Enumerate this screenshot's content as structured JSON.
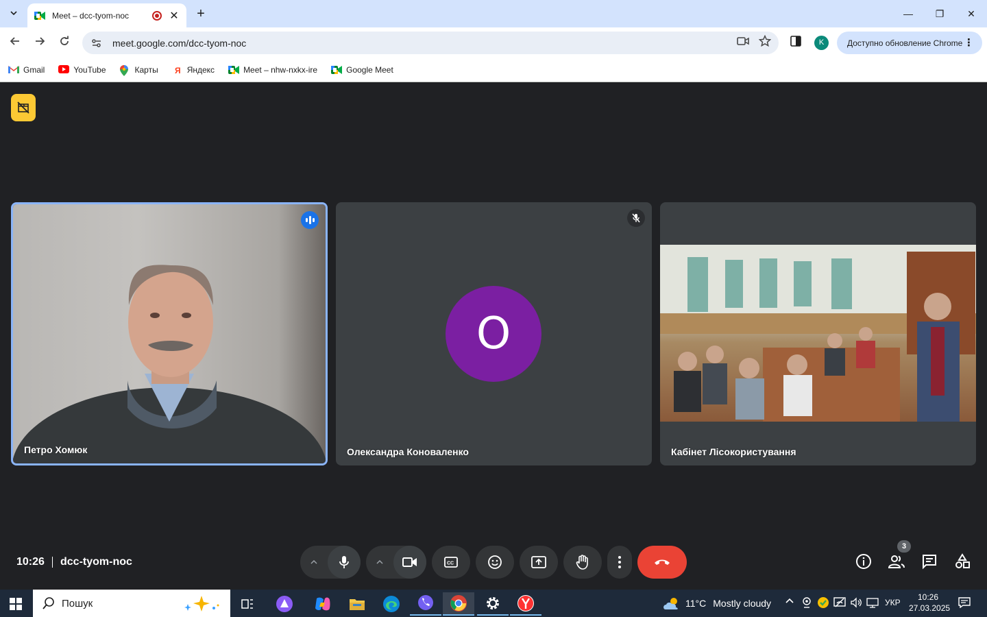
{
  "browser": {
    "tab": {
      "title": "Meet – dcc-tyom-noc"
    },
    "window_controls": {
      "minimize": "—",
      "maximize": "❐",
      "close": "✕"
    },
    "url": "meet.google.com/dcc-tyom-noc",
    "profile_initial": "K",
    "update_label": "Доступно обновление Chrome",
    "bookmarks": [
      {
        "label": "Gmail",
        "icon": "gmail-icon"
      },
      {
        "label": "YouTube",
        "icon": "youtube-icon"
      },
      {
        "label": "Карты",
        "icon": "maps-icon"
      },
      {
        "label": "Яндекс",
        "icon": "yandex-icon"
      },
      {
        "label": "Meet – nhw-nxkx-ire",
        "icon": "meet-icon"
      },
      {
        "label": "Google Meet",
        "icon": "meet-icon"
      }
    ]
  },
  "meet": {
    "participants": [
      {
        "name": "Петро Хомюк",
        "state": "speaking"
      },
      {
        "name": "Олександра Коноваленко",
        "state": "muted",
        "avatar_letter": "O",
        "avatar_color": "#7b1fa2"
      },
      {
        "name": "Кабінет Лісокористування",
        "state": "video"
      }
    ],
    "time": "10:26",
    "meeting_code": "dcc-tyom-noc",
    "people_count": "3",
    "colors": {
      "leave": "#ea4335",
      "active_border": "#8ab4f8",
      "speaking": "#1a73e8"
    }
  },
  "taskbar": {
    "search_placeholder": "Пошук",
    "weather_temp": "11°C",
    "weather_text": "Mostly cloudy",
    "language": "УКР",
    "time": "10:26",
    "date": "27.03.2025"
  }
}
